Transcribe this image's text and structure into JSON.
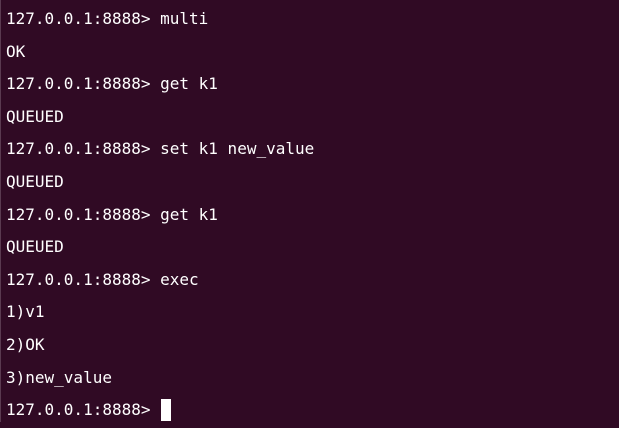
{
  "terminal": {
    "lines": [
      {
        "text": "127.0.0.1:8888> multi"
      },
      {
        "text": "OK"
      },
      {
        "text": "127.0.0.1:8888> get k1"
      },
      {
        "text": "QUEUED"
      },
      {
        "text": "127.0.0.1:8888> set k1 new_value"
      },
      {
        "text": "QUEUED"
      },
      {
        "text": "127.0.0.1:8888> get k1"
      },
      {
        "text": "QUEUED"
      },
      {
        "text": "127.0.0.1:8888> exec"
      },
      {
        "text": "1)v1"
      },
      {
        "text": "2)OK"
      },
      {
        "text": "3)new_value"
      }
    ],
    "prompt": "127.0.0.1:8888>"
  },
  "colors": {
    "background": "#300a24",
    "text": "#ffffff",
    "cursor": "#ffffff"
  }
}
